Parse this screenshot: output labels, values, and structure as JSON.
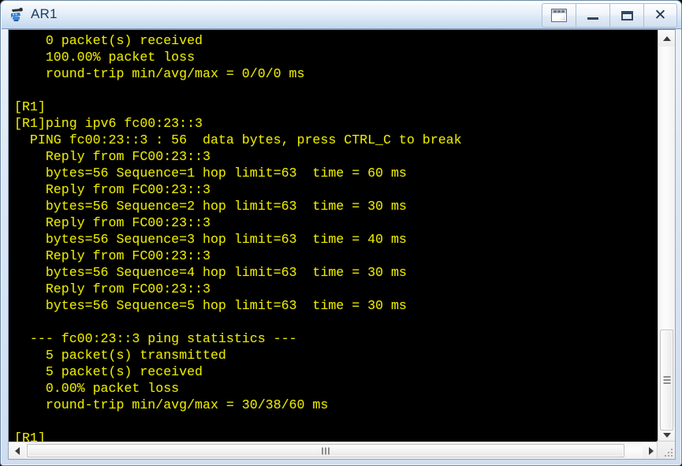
{
  "window": {
    "title": "AR1",
    "icon": "router-device-icon",
    "buttons": [
      {
        "name": "panel-button",
        "label": "",
        "glyph": "panel-window-icon"
      },
      {
        "name": "minimize-button",
        "label": "",
        "glyph": "minimize-icon"
      },
      {
        "name": "maximize-button",
        "label": "",
        "glyph": "maximize-icon"
      },
      {
        "name": "close-button",
        "label": "✕",
        "glyph": "close-icon"
      }
    ]
  },
  "terminal": {
    "foreground_color": "#e8e800",
    "background_color": "#000000",
    "lines": [
      "    0 packet(s) received",
      "    100.00% packet loss",
      "    round-trip min/avg/max = 0/0/0 ms",
      "",
      "[R1]",
      "[R1]ping ipv6 fc00:23::3",
      "  PING fc00:23::3 : 56  data bytes, press CTRL_C to break",
      "    Reply from FC00:23::3",
      "    bytes=56 Sequence=1 hop limit=63  time = 60 ms",
      "    Reply from FC00:23::3",
      "    bytes=56 Sequence=2 hop limit=63  time = 30 ms",
      "    Reply from FC00:23::3",
      "    bytes=56 Sequence=3 hop limit=63  time = 40 ms",
      "    Reply from FC00:23::3",
      "    bytes=56 Sequence=4 hop limit=63  time = 30 ms",
      "    Reply from FC00:23::3",
      "    bytes=56 Sequence=5 hop limit=63  time = 30 ms",
      "",
      "  --- fc00:23::3 ping statistics ---",
      "    5 packet(s) transmitted",
      "    5 packet(s) received",
      "    0.00% packet loss",
      "    round-trip min/avg/max = 30/38/60 ms",
      "",
      "[R1]"
    ]
  },
  "scrollbars": {
    "vertical": {
      "up_arrow": "scroll-up-icon",
      "down_arrow": "scroll-down-icon",
      "thumb_top_pct": 79,
      "thumb_height_pct": 24
    },
    "horizontal": {
      "left_arrow": "scroll-left-icon",
      "right_arrow": "scroll-right-icon",
      "thumb_left_pct": 3,
      "thumb_width_pct": 85
    },
    "resize_grip": "resize-grip-icon"
  }
}
